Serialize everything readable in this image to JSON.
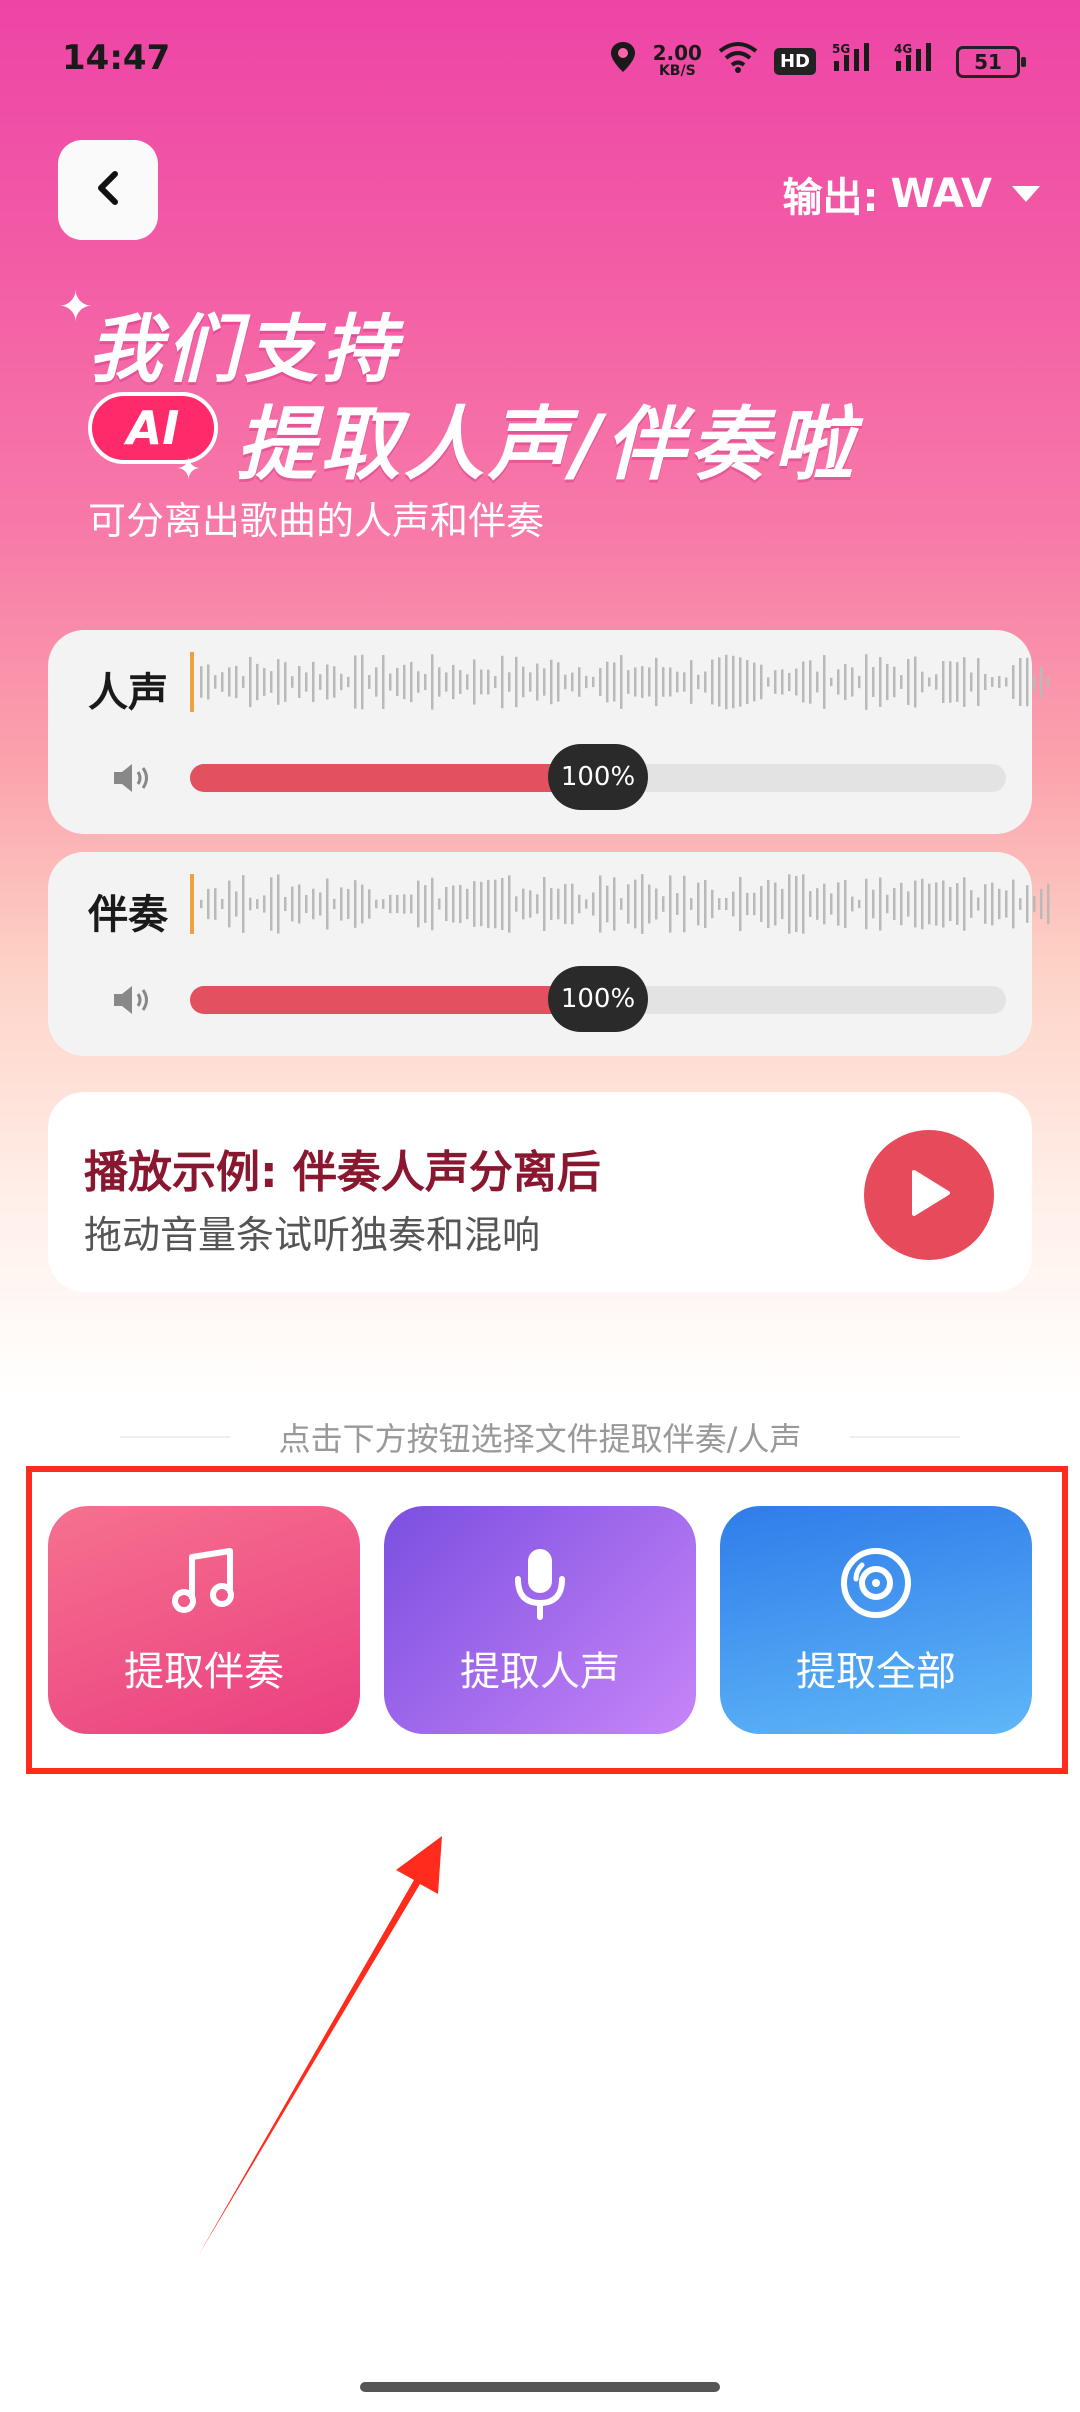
{
  "status_bar": {
    "time": "14:47",
    "net_speed": "2.00",
    "net_unit": "KB/S",
    "hd": "HD",
    "sig1": "5G",
    "sig2": "4G",
    "battery": "51"
  },
  "header": {
    "output_label": "输出:",
    "output_value": "WAV"
  },
  "hero": {
    "line1": "我们支持",
    "ai_badge": "AI",
    "line2": "提取人声/伴奏啦",
    "subtitle": "可分离出歌曲的人声和伴奏"
  },
  "tracks": [
    {
      "label": "人声",
      "volume": "100%",
      "level": 0.5
    },
    {
      "label": "伴奏",
      "volume": "100%",
      "level": 0.5
    }
  ],
  "demo": {
    "title": "播放示例: 伴奏人声分离后",
    "desc": "拖动音量条试听独奏和混响"
  },
  "hint": "点击下方按钮选择文件提取伴奏/人声",
  "actions": [
    {
      "label": "提取伴奏",
      "icon": "music-note-icon"
    },
    {
      "label": "提取人声",
      "icon": "microphone-icon"
    },
    {
      "label": "提取全部",
      "icon": "disc-icon"
    }
  ],
  "colors": {
    "accent": "#e35060",
    "highlight": "#ff2b1c"
  }
}
